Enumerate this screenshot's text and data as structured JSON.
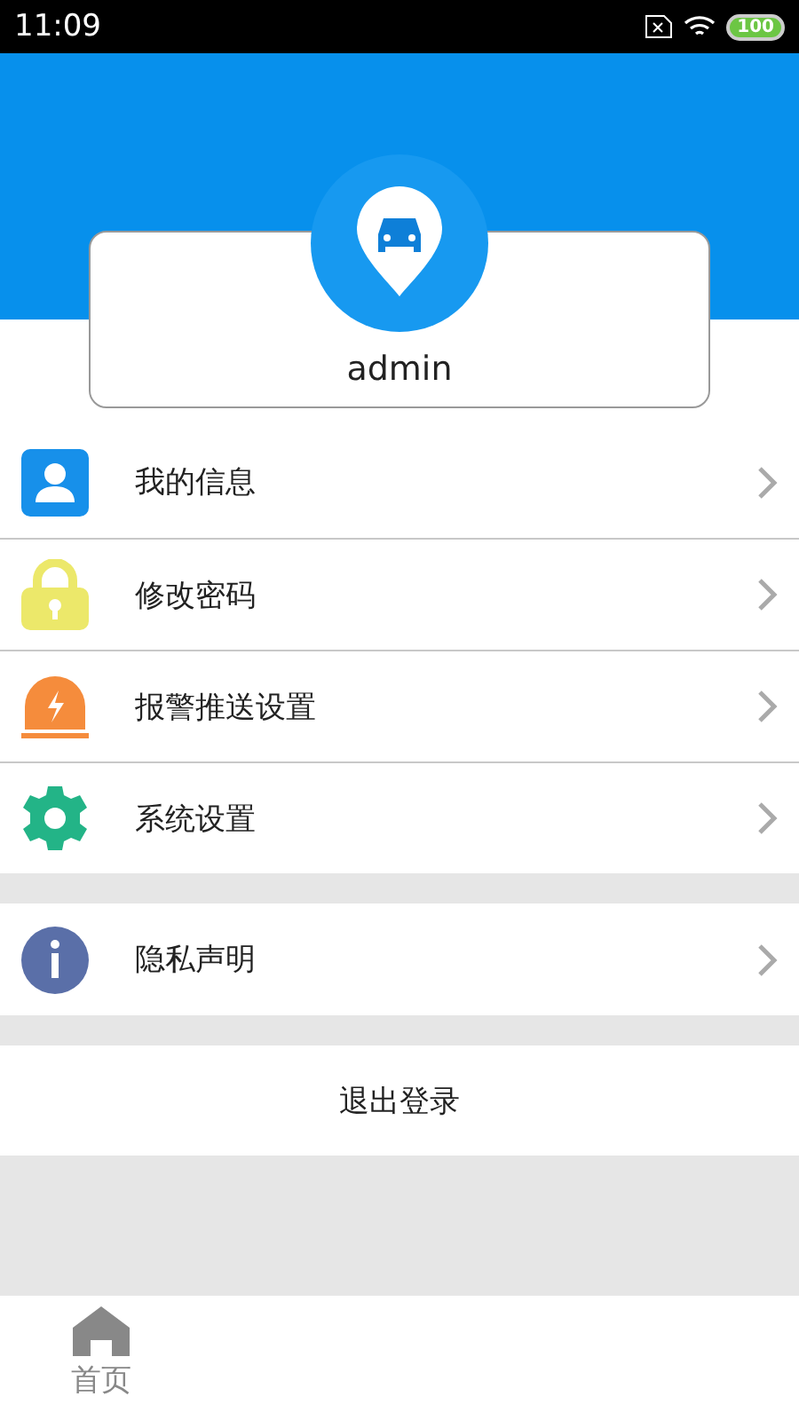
{
  "status_bar": {
    "time": "11:09",
    "battery": "100"
  },
  "profile": {
    "username": "admin"
  },
  "menu_groups": [
    [
      {
        "label": "我的信息",
        "kind": "person"
      },
      {
        "label": "修改密码",
        "kind": "lock"
      },
      {
        "label": "报警推送设置",
        "kind": "alarm"
      },
      {
        "label": "系统设置",
        "kind": "gear"
      }
    ],
    [
      {
        "label": "隐私声明",
        "kind": "info"
      }
    ]
  ],
  "logout_button": "退出登录",
  "tab_bar": [
    {
      "label": "首页",
      "kind": "home"
    }
  ]
}
